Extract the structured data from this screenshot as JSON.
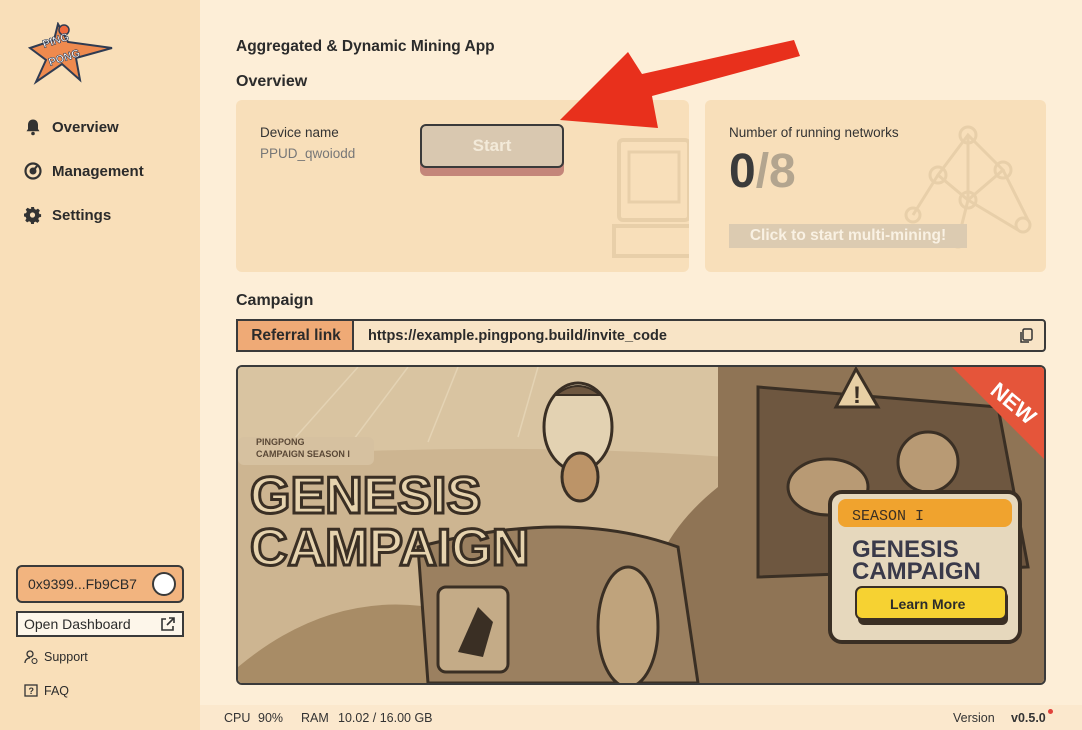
{
  "logo": {
    "line1": "PING",
    "line2": "PONG"
  },
  "sidebar": {
    "items": [
      {
        "label": "Overview",
        "icon": "bell-icon"
      },
      {
        "label": "Management",
        "icon": "gauge-icon"
      },
      {
        "label": "Settings",
        "icon": "gear-icon"
      }
    ],
    "wallet": "0x9399...Fb9CB7",
    "dashboard": "Open Dashboard",
    "support": "Support",
    "faq": "FAQ"
  },
  "main": {
    "app_title": "Aggregated & Dynamic Mining App",
    "overview_title": "Overview",
    "device": {
      "label": "Device name",
      "value": "PPUD_qwoiodd",
      "start": "Start"
    },
    "networks": {
      "label": "Number of running networks",
      "running": "0",
      "total": "/8",
      "cta": "Click to start multi-mining!"
    },
    "campaign_title": "Campaign",
    "referral": {
      "label": "Referral link",
      "url": "https://example.pingpong.build/invite_code"
    },
    "banner": {
      "badge": "NEW",
      "kicker_line1": "PINGPONG",
      "kicker_line2": "CAMPAIGN SEASON I",
      "title_line1": "GENESIS",
      "title_line2": "CAMPAIGN",
      "sign_season": "SEASON I",
      "sign_line1": "GENESIS",
      "sign_line2": "CAMPAIGN",
      "learn_more": "Learn More"
    }
  },
  "footer": {
    "cpu_label": "CPU",
    "cpu_value": "90%",
    "ram_label": "RAM",
    "ram_value": "10.02 / 16.00 GB",
    "version_label": "Version",
    "version_value": "v0.5.0"
  },
  "colors": {
    "accent": "#f2b47f",
    "arrow": "#e8301c",
    "sidebar_bg": "#f9dfb9",
    "page_bg": "#fdeed7"
  }
}
